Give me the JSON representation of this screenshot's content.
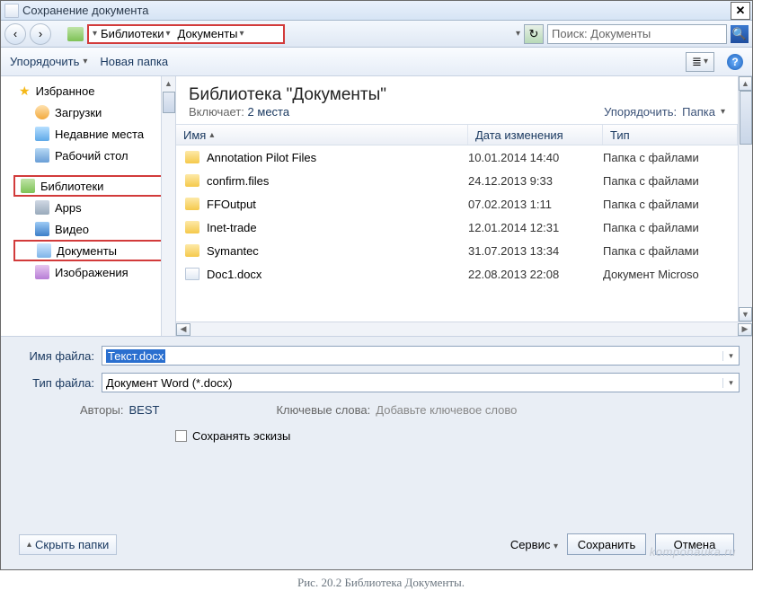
{
  "titlebar": {
    "title": "Сохранение документа"
  },
  "breadcrumb": {
    "seg1": "Библиотеки",
    "seg2": "Документы"
  },
  "search": {
    "placeholder": "Поиск: Документы"
  },
  "toolbar": {
    "organize": "Упорядочить",
    "newfolder": "Новая папка"
  },
  "tree": {
    "favorites": "Избранное",
    "downloads": "Загрузки",
    "recent": "Недавние места",
    "desktop": "Рабочий стол",
    "libraries": "Библиотеки",
    "apps": "Apps",
    "video": "Видео",
    "documents": "Документы",
    "images": "Изображения"
  },
  "library": {
    "title": "Библиотека \"Документы\"",
    "includes_label": "Включает:",
    "includes_value": "2 места",
    "arrange_label": "Упорядочить:",
    "arrange_value": "Папка"
  },
  "columns": {
    "name": "Имя",
    "date": "Дата изменения",
    "type": "Тип"
  },
  "rows": [
    {
      "name": "Annotation Pilot Files",
      "date": "10.01.2014 14:40",
      "type": "Папка с файлами",
      "kind": "folder"
    },
    {
      "name": "confirm.files",
      "date": "24.12.2013 9:33",
      "type": "Папка с файлами",
      "kind": "folder"
    },
    {
      "name": "FFOutput",
      "date": "07.02.2013 1:11",
      "type": "Папка с файлами",
      "kind": "folder"
    },
    {
      "name": "Inet-trade",
      "date": "12.01.2014 12:31",
      "type": "Папка с файлами",
      "kind": "folder"
    },
    {
      "name": "Symantec",
      "date": "31.07.2013 13:34",
      "type": "Папка с файлами",
      "kind": "folder"
    },
    {
      "name": "Doc1.docx",
      "date": "22.08.2013 22:08",
      "type": "Документ Microso",
      "kind": "file"
    }
  ],
  "form": {
    "filename_label": "Имя файла:",
    "filename_value": "Текст.docx",
    "filetype_label": "Тип файла:",
    "filetype_value": "Документ Word (*.docx)",
    "authors_label": "Авторы:",
    "authors_value": "BEST",
    "keywords_label": "Ключевые слова:",
    "keywords_value": "Добавьте ключевое слово",
    "thumbnails": "Сохранять эскизы"
  },
  "footer": {
    "hide": "Скрыть папки",
    "tools": "Сервис",
    "save": "Сохранить",
    "cancel": "Отмена"
  },
  "watermark": "komponauka.ru",
  "caption": "Рис. 20.2 Библиотека Документы."
}
